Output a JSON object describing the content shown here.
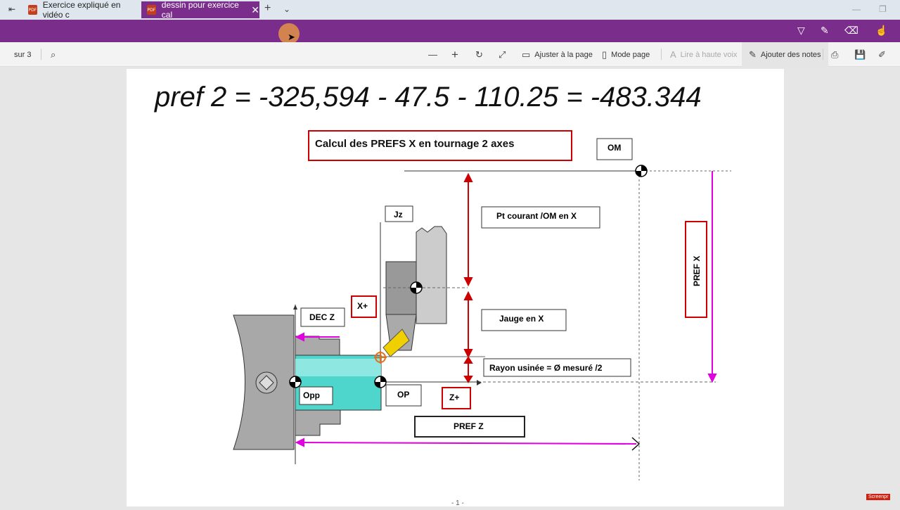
{
  "tabs": [
    {
      "label": "Exercice expliqué en vidéo c",
      "active": false
    },
    {
      "label": "dessin pour exercice cal",
      "active": true
    }
  ],
  "toolbar": {
    "page_of": "sur 3",
    "fit_page": "Ajuster à la page",
    "page_mode": "Mode page",
    "read_aloud": "Lire à haute voix",
    "add_notes": "Ajouter des notes"
  },
  "handwriting": "pref 2 = -325,594 - 47.5 - 110.25 = -483.344",
  "drawing": {
    "title": "Calcul des PREFS X en tournage 2 axes",
    "om": "OM",
    "jz": "Jz",
    "pt_courant": "Pt courant /OM en X",
    "jauge": "Jauge en X",
    "rayon": "Rayon usinée = Ø mesuré /2",
    "dec_z": "DEC Z",
    "x_plus": "X+",
    "z_plus": "Z+",
    "opp": "Opp",
    "op": "OP",
    "pref_z": "PREF Z",
    "pref_x": "PREF X",
    "page_num": "- 1 -"
  },
  "colors": {
    "accent": "#7b2d8b",
    "red": "#cc0000",
    "magenta": "#e000e0",
    "workpiece": "#4fd6cc"
  },
  "footer_badge": "Screenpr"
}
